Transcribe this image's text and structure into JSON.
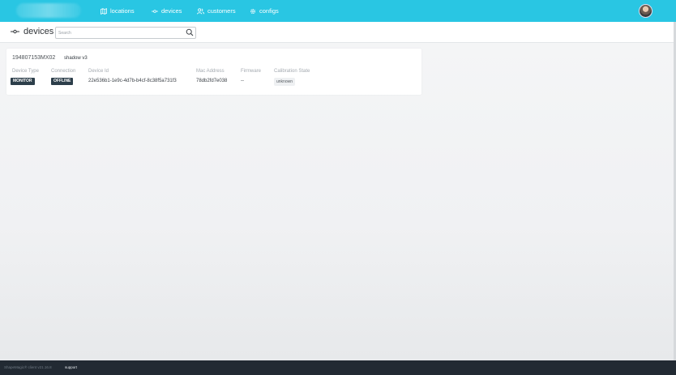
{
  "nav": {
    "items": [
      {
        "label": "locations",
        "icon": "map-icon"
      },
      {
        "label": "devices",
        "icon": "device-icon"
      },
      {
        "label": "customers",
        "icon": "users-icon"
      },
      {
        "label": "configs",
        "icon": "gear-icon"
      }
    ],
    "accent_color": "#29c6e3"
  },
  "header": {
    "title": "devices",
    "title_icon": "device-icon",
    "search": {
      "placeholder": "Search",
      "value": ""
    }
  },
  "device_card": {
    "serial": "194807153MX02",
    "model": "shadow v3",
    "columns": [
      {
        "label": "Device Type",
        "value": "MONITOR"
      },
      {
        "label": "Connection",
        "value": "OFFLINE"
      },
      {
        "label": "Device Id",
        "value": "22e536b1-1e9c-4d7b-b4cf-8c38f5a731f3"
      },
      {
        "label": "Mac Address",
        "value": "78db2fd7e038"
      },
      {
        "label": "Firmware",
        "value": "--"
      },
      {
        "label": "Calibration State",
        "value": "unknown"
      }
    ]
  },
  "footer": {
    "version": "ShapeMagic® client v21.16.8",
    "support_label": "support"
  }
}
